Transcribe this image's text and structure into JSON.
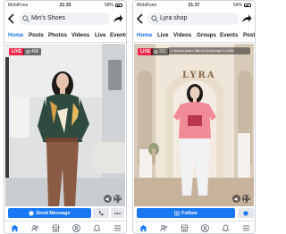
{
  "phones": [
    {
      "status": {
        "carrier": "MobiFone",
        "time": "21:33",
        "battery": "58%",
        "battery_level": 0.58
      },
      "search_text": "Min's Shoes",
      "tabs": [
        {
          "label": "Home",
          "active": true
        },
        {
          "label": "Posts",
          "active": false
        },
        {
          "label": "Photos",
          "active": false
        },
        {
          "label": "Videos",
          "active": false
        },
        {
          "label": "Live",
          "active": false
        },
        {
          "label": "Events",
          "active": false
        }
      ],
      "video": {
        "live_label": "LIVE",
        "viewers": "456",
        "comment": ""
      },
      "primary_action": {
        "label": "Send Message",
        "icon": "messenger-icon"
      },
      "secondary_actions": [
        {
          "icon": "phone-icon"
        },
        {
          "icon": "more-icon"
        }
      ],
      "bottom_nav": [
        "home-icon",
        "friends-icon",
        "marketplace-icon",
        "profile-icon",
        "notifications-icon",
        "menu-icon"
      ]
    },
    {
      "status": {
        "carrier": "MobiFone",
        "time": "21:37",
        "battery": "54%",
        "battery_level": 0.54
      },
      "search_text": "Lyra shop",
      "tabs": [
        {
          "label": "Home",
          "active": true
        },
        {
          "label": "Live",
          "active": false
        },
        {
          "label": "Videos",
          "active": false
        },
        {
          "label": "Groups",
          "active": false
        },
        {
          "label": "Events",
          "active": false
        },
        {
          "label": "Posts",
          "active": false
        }
      ],
      "video": {
        "live_label": "LIVE",
        "viewers": "311",
        "comment": "2 skinny jeans 98k! Ai Ai phòng thì 125k",
        "store_sign": "LYRA"
      },
      "primary_action": {
        "label": "Follow",
        "icon": "follow-icon"
      },
      "secondary_actions": [
        {
          "icon": "messenger-icon"
        }
      ],
      "bottom_nav": [
        "home-icon",
        "friends-icon",
        "marketplace-icon",
        "profile-icon",
        "notifications-icon",
        "menu-icon"
      ]
    }
  ],
  "colors": {
    "accent": "#1877f2",
    "live": "#f02849",
    "button_gray": "#e4e6eb"
  }
}
